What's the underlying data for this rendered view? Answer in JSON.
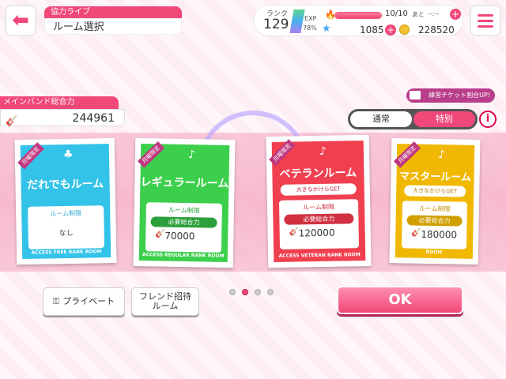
{
  "header": {
    "subtitle": "協力ライブ",
    "title": "ルーム選択",
    "rank_label": "ランク",
    "rank": "129",
    "exp_label": "EXP",
    "exp_percent": "78%",
    "exp_fraction": 0.78,
    "stamina": "10/10",
    "stamina_fraction": 1.0,
    "remaining_label": "あと",
    "remaining_value": "--:--",
    "stars": "1085",
    "coins": "228520",
    "accent_color": "#f04878"
  },
  "band_power": {
    "label": "メインバンド総合力",
    "value": "244961"
  },
  "ticket_banner": "練習チケット割合UP!",
  "tabs": [
    {
      "label": "通常",
      "active": false
    },
    {
      "label": "特別",
      "active": true
    }
  ],
  "cards": [
    {
      "ribbon": "月曜限定",
      "name": "だれでもルーム",
      "panel_label": "ルーム制限",
      "panel_value": "なし",
      "footer": "ACCESS FREE RANK ROOM",
      "color": "#33c3e8"
    },
    {
      "ribbon": "月曜限定",
      "name": "レギュラールーム",
      "panel_label": "ルーム制限",
      "req_label": "必要総合力",
      "req_value": "70000",
      "footer": "ACCESS REGULAR RANK ROOM",
      "color": "#3ccf4c"
    },
    {
      "ribbon": "月曜限定",
      "name": "ベテランルーム",
      "bonus": "大きなかけらGET",
      "panel_label": "ルーム制限",
      "req_label": "必要総合力",
      "req_value": "120000",
      "footer": "ACCESS VETERAN RANK ROOM",
      "color": "#f0404f"
    },
    {
      "ribbon": "月曜限定",
      "name": "マスタールーム",
      "bonus": "大きなかけらGET",
      "panel_label": "ルーム制限",
      "req_label": "必要総合力",
      "req_value": "180000",
      "footer": "ACCESS MASTER RANK ROOM",
      "color": "#f0b800"
    }
  ],
  "buttons": {
    "private": "プライベート",
    "friend_line1": "フレンド招待",
    "friend_line2": "ルーム",
    "ok": "OK"
  },
  "pager": {
    "total": 4,
    "current": 2
  }
}
